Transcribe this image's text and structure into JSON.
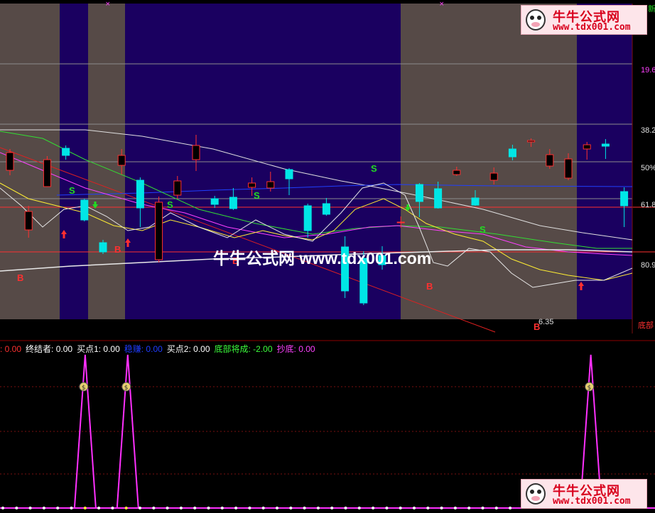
{
  "watermark": {
    "text": "牛牛公式网 www.tdx001.com"
  },
  "logo": {
    "title": "牛牛公式网",
    "url": "www.tdx001.com"
  },
  "top_marks": {
    "right_label": "新"
  },
  "price_labels": [
    "19.6",
    "38.2",
    "50%",
    "61.8",
    "80.9",
    "底部"
  ],
  "low_label": "6.35",
  "candle_marks": {
    "sell": "S",
    "buy": "B",
    "buy_alt": "B"
  },
  "coin_label": "$",
  "legend": [
    {
      "label": "",
      "value": "0.00",
      "color": "#ff3030"
    },
    {
      "label": "终结者",
      "value": "0.00",
      "color": "#ffffff"
    },
    {
      "label": "买点1",
      "value": "0.00",
      "color": "#ffffff"
    },
    {
      "label": "稳赚",
      "value": "0.00",
      "color": "#1f3cff"
    },
    {
      "label": "买点2",
      "value": "0.00",
      "color": "#ffffff"
    },
    {
      "label": "底部将成",
      "value": "-2.00",
      "color": "#3cff3c"
    },
    {
      "label": "抄底",
      "value": "0.00",
      "color": "#ff40ff"
    }
  ],
  "colors": {
    "grey_band": "#564a47",
    "blue_band": "#1a0060",
    "up": "#ff3030",
    "down": "#00e6e6",
    "ma_white": "#e0e0e0",
    "ma_yellow": "#ffee33",
    "ma_green": "#33dd33",
    "ma_magenta": "#ff40ff",
    "ma_blue": "#2040ff",
    "ind_line": "#ff30ff"
  },
  "chart_data": {
    "type": "candlestick",
    "candles": [
      [
        25.0,
        27.5,
        24.3,
        28.0
      ],
      [
        16.6,
        19.2,
        15.5,
        20.0
      ],
      [
        22.7,
        26.5,
        22.7,
        27.0
      ],
      [
        28.1,
        27.1,
        26.5,
        28.5
      ],
      [
        20.8,
        18.0,
        17.8,
        21.0
      ],
      [
        14.8,
        13.5,
        13.2,
        15.2
      ],
      [
        25.7,
        27.1,
        24.4,
        28.0
      ],
      [
        23.6,
        19.7,
        17.0,
        24.0
      ],
      [
        12.4,
        20.5,
        12.0,
        21.3
      ],
      [
        21.5,
        23.5,
        21.0,
        24.2
      ],
      [
        26.5,
        28.5,
        24.9,
        30.0
      ],
      [
        21.0,
        20.2,
        19.7,
        21.4
      ],
      [
        21.2,
        19.6,
        19.4,
        22.5
      ],
      [
        22.6,
        23.2,
        21.4,
        24.0
      ],
      [
        22.5,
        23.4,
        22.0,
        24.8
      ],
      [
        25.1,
        23.8,
        21.5,
        25.3
      ],
      [
        20.0,
        16.5,
        15.5,
        20.3
      ],
      [
        20.3,
        18.8,
        18.6,
        21.1
      ],
      [
        14.2,
        8.0,
        7.0,
        15.7
      ],
      [
        12.6,
        6.3,
        6.0,
        13.6
      ],
      [
        13.0,
        11.7,
        11.0,
        14.3
      ],
      [
        17.7,
        17.7,
        16.9,
        18.5
      ],
      [
        23.0,
        20.6,
        18.4,
        23.2
      ],
      [
        22.4,
        19.7,
        19.6,
        23.4
      ],
      [
        24.4,
        25.0,
        24.2,
        25.5
      ],
      [
        21.1,
        20.1,
        20.0,
        22.2
      ],
      [
        23.6,
        24.6,
        23.0,
        25.4
      ],
      [
        28.0,
        26.9,
        26.4,
        28.6
      ],
      [
        29.0,
        29.2,
        28.3,
        29.5
      ],
      [
        25.6,
        27.2,
        25.2,
        28.0
      ],
      [
        23.9,
        26.6,
        23.6,
        27.4
      ],
      [
        28.0,
        28.6,
        26.5,
        29.0
      ],
      [
        28.7,
        28.4,
        26.6,
        29.4
      ],
      [
        22.0,
        20.0,
        17.0,
        22.6
      ]
    ],
    "ma_series": [
      "MA5",
      "MA10",
      "MA20",
      "MA60",
      "MA120"
    ],
    "indicator": {
      "peaks_at": [
        0.13,
        0.195,
        0.902
      ],
      "peak_value": 100,
      "base_value": 0
    }
  }
}
